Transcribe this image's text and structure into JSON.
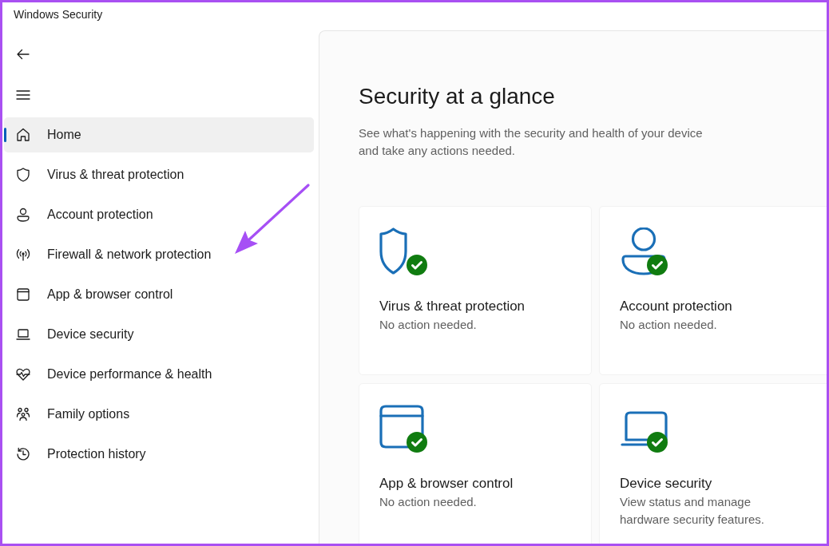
{
  "window": {
    "title": "Windows Security"
  },
  "sidebar": {
    "items": [
      {
        "label": "Home",
        "selected": true
      },
      {
        "label": "Virus & threat protection",
        "selected": false
      },
      {
        "label": "Account protection",
        "selected": false
      },
      {
        "label": "Firewall & network protection",
        "selected": false
      },
      {
        "label": "App & browser control",
        "selected": false
      },
      {
        "label": "Device security",
        "selected": false
      },
      {
        "label": "Device performance & health",
        "selected": false
      },
      {
        "label": "Family options",
        "selected": false
      },
      {
        "label": "Protection history",
        "selected": false
      }
    ]
  },
  "main": {
    "heading": "Security at a glance",
    "description": "See what's happening with the security and health of your device and take any actions needed.",
    "cards": [
      {
        "title": "Virus & threat protection",
        "subtitle": "No action needed.",
        "protected": true
      },
      {
        "title": "Account protection",
        "subtitle": "No action needed.",
        "protected": true
      },
      {
        "title": "App & browser control",
        "subtitle": "No action needed.",
        "protected": true
      },
      {
        "title": "Device security",
        "subtitle": "View status and manage hardware security features.",
        "protected": true
      }
    ]
  }
}
